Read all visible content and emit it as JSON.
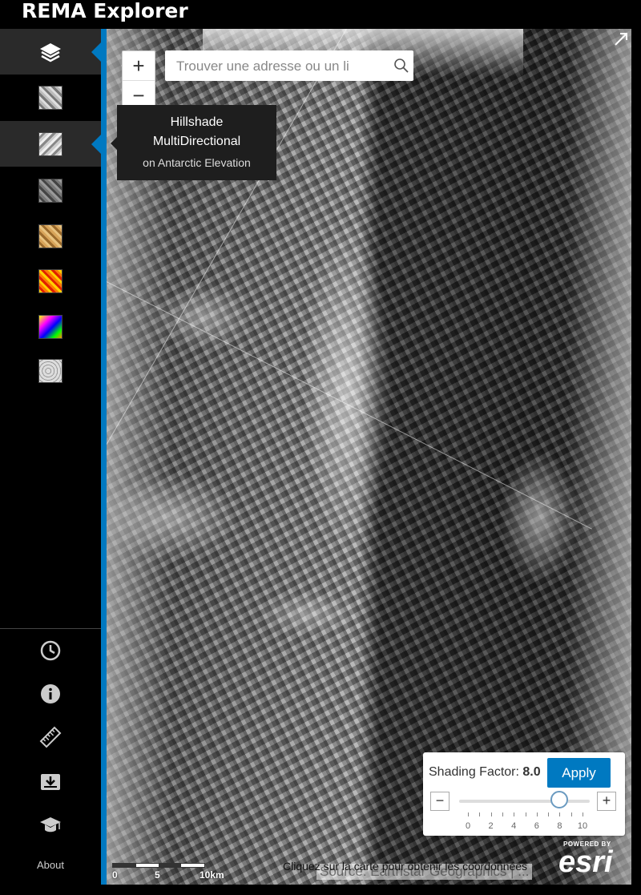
{
  "app": {
    "title": "REMA Explorer"
  },
  "sidebar": {
    "layers_tooltip": {
      "title": "Hillshade MultiDirectional",
      "subtitle": "on Antarctic Elevation"
    },
    "about_label": "About"
  },
  "map": {
    "search": {
      "placeholder": "Trouver une adresse ou un li"
    },
    "zoom_in_label": "+",
    "zoom_out_label": "−",
    "scale_labels": [
      "0",
      "5",
      "10km"
    ],
    "click_hint": "Cliquez sur la carte pour obtenir les coordonnées",
    "source": "Source: Earthstar Geographics | ...",
    "powered_by": "POWERED BY",
    "esri_logo_text": "esri"
  },
  "shading_panel": {
    "label": "Shading Factor: ",
    "value": "8.0",
    "apply_label": "Apply",
    "minus_label": "−",
    "plus_label": "+",
    "slider": {
      "min": 0,
      "max": 10,
      "value": 8.0
    },
    "tick_labels": [
      "0",
      "2",
      "4",
      "6",
      "8",
      "10"
    ]
  },
  "colors": {
    "accent": "#0079c1",
    "background": "#000000"
  }
}
